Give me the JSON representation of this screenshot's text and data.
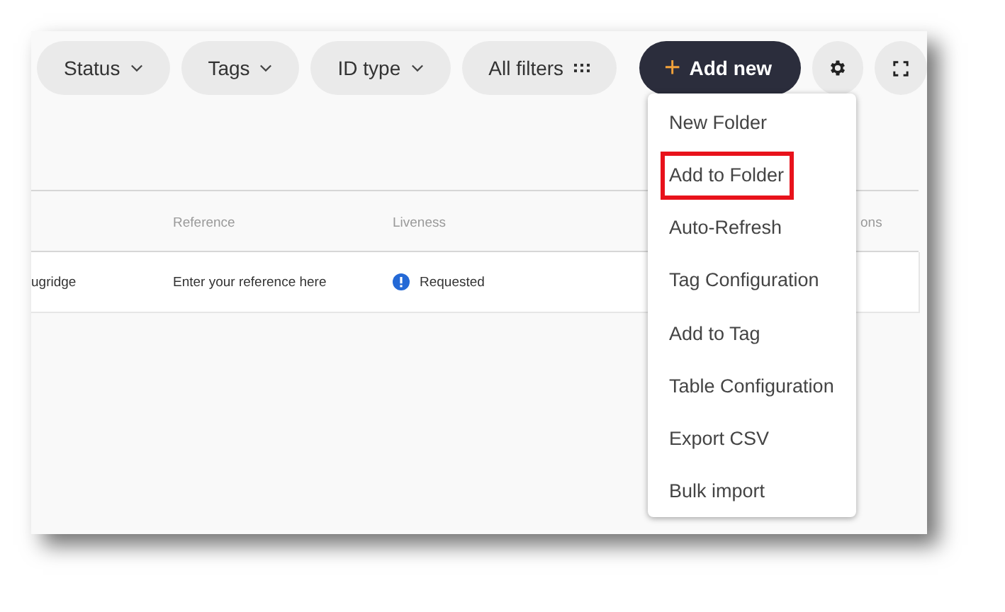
{
  "toolbar": {
    "filters": [
      {
        "label": "Status",
        "kind": "dropdown"
      },
      {
        "label": "Tags",
        "kind": "dropdown"
      },
      {
        "label": "ID type",
        "kind": "dropdown"
      },
      {
        "label": "All filters",
        "kind": "grid"
      }
    ],
    "add_button": {
      "icon": "+",
      "label": "Add new"
    }
  },
  "table": {
    "columns": [
      "Reference",
      "Liveness",
      "ons"
    ],
    "rows": [
      {
        "name": "ugridge",
        "reference": "Enter your reference here",
        "liveness": "Requested"
      }
    ]
  },
  "menu": {
    "items": [
      {
        "label": "New Folder",
        "highlighted": false
      },
      {
        "label": "Add to Folder",
        "highlighted": true
      },
      {
        "label": "Auto-Refresh",
        "highlighted": false
      },
      {
        "label": "Tag Configuration",
        "highlighted": false
      },
      {
        "label": "Add to Tag",
        "highlighted": false
      },
      {
        "label": "Table Configuration",
        "highlighted": false
      },
      {
        "label": "Export CSV",
        "highlighted": false
      },
      {
        "label": "Bulk import",
        "highlighted": false
      }
    ]
  }
}
